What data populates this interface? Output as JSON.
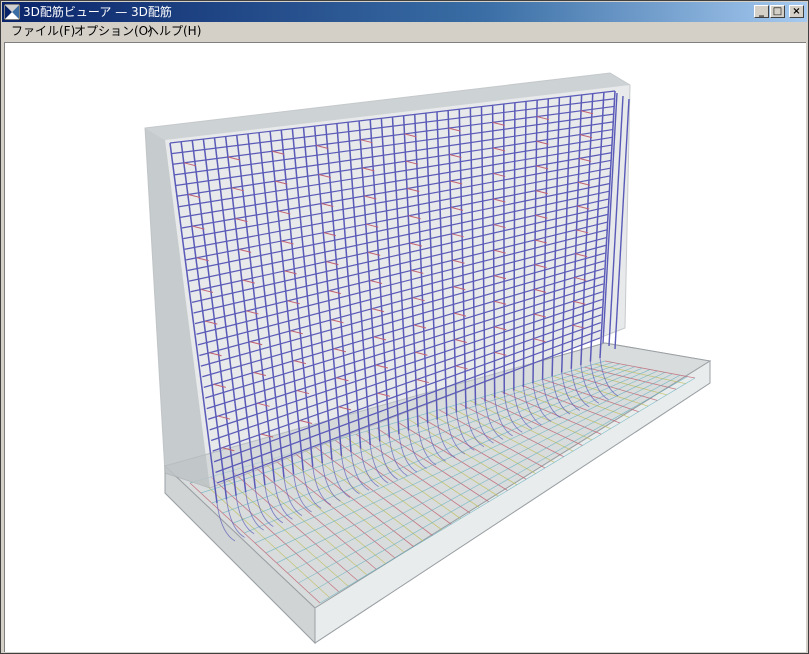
{
  "window": {
    "title": "3D配筋ビューア — 3D配筋",
    "controls": {
      "minimize": "_",
      "maximize": "□",
      "close": "×"
    }
  },
  "menu": {
    "items": [
      {
        "label": "ファイル(F)"
      },
      {
        "label": "オプション(O)"
      },
      {
        "label": "ヘルプ(H)"
      }
    ]
  },
  "viewport": {
    "background": "#ffffff",
    "colors": {
      "concrete": "#c8cdd0",
      "concrete_edge": "#9aa0a4",
      "rebar_blue": "#5a5ab8",
      "rebar_red": "#c06070",
      "rebar_yellow": "#c0c060",
      "rebar_cyan": "#60b0c0"
    }
  }
}
